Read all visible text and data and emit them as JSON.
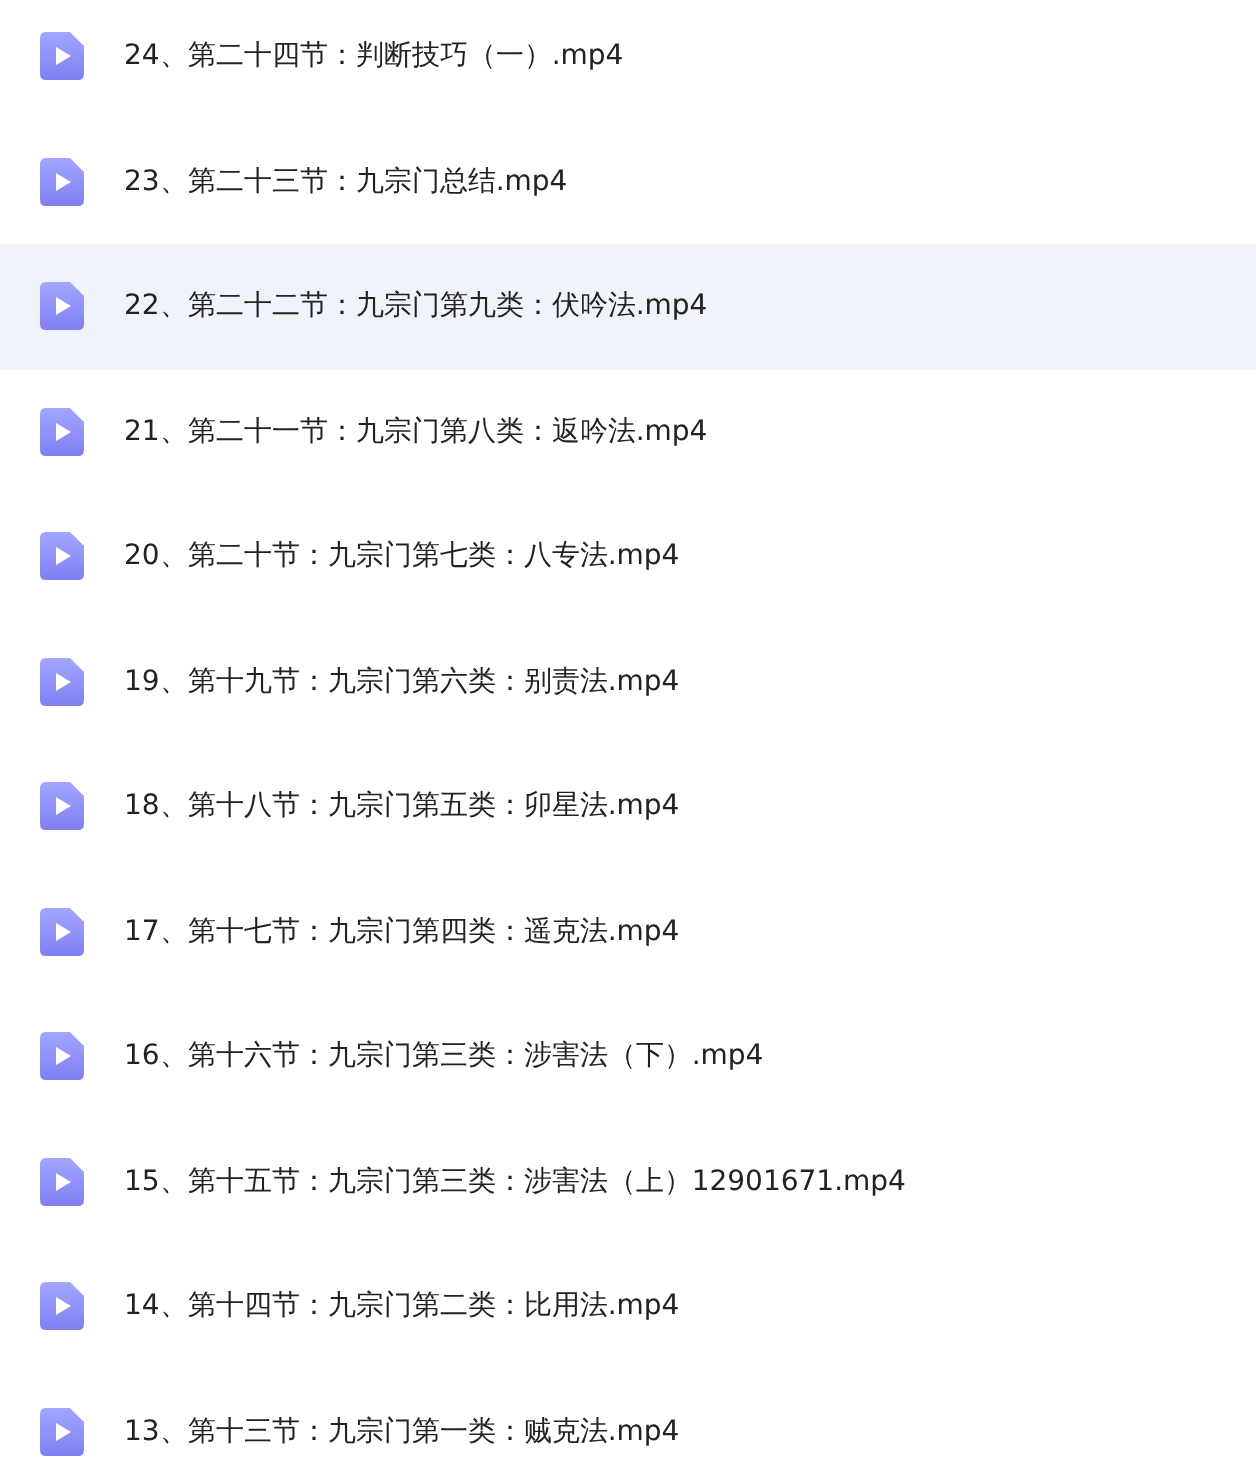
{
  "files": [
    {
      "name": "24、第二十四节：判断技巧（一）.mp4",
      "selected": false
    },
    {
      "name": "23、第二十三节：九宗门总结.mp4",
      "selected": false
    },
    {
      "name": "22、第二十二节：九宗门第九类：伏吟法.mp4",
      "selected": true
    },
    {
      "name": "21、第二十一节：九宗门第八类：返吟法.mp4",
      "selected": false
    },
    {
      "name": "20、第二十节：九宗门第七类：八专法.mp4",
      "selected": false
    },
    {
      "name": "19、第十九节：九宗门第六类：别责法.mp4",
      "selected": false
    },
    {
      "name": "18、第十八节：九宗门第五类：卯星法.mp4",
      "selected": false
    },
    {
      "name": "17、第十七节：九宗门第四类：遥克法.mp4",
      "selected": false
    },
    {
      "name": "16、第十六节：九宗门第三类：涉害法（下）.mp4",
      "selected": false
    },
    {
      "name": "15、第十五节：九宗门第三类：涉害法（上）12901671.mp4",
      "selected": false
    },
    {
      "name": "14、第十四节：九宗门第二类：比用法.mp4",
      "selected": false
    },
    {
      "name": "13、第十三节：九宗门第一类：贼克法.mp4",
      "selected": false
    }
  ]
}
